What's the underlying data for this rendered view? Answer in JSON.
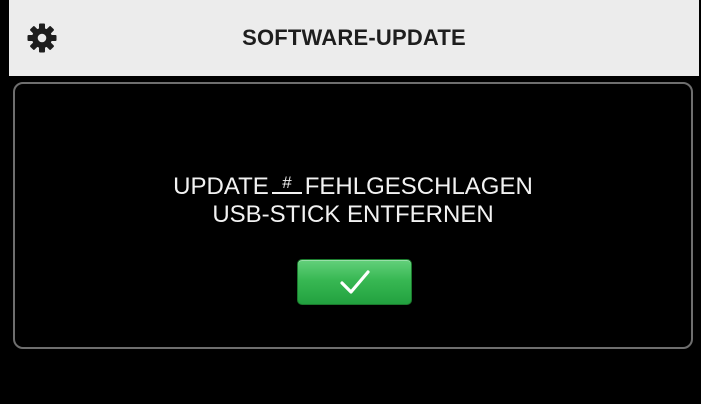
{
  "header": {
    "title": "SOFTWARE-UPDATE",
    "settings_icon": "gear-icon"
  },
  "dialog": {
    "line1_prefix": "UPDATE",
    "update_id": "#",
    "line1_suffix": "FEHLGESCHLAGEN",
    "line2": "USB-STICK ENTFERNEN",
    "confirm_icon": "checkmark-icon",
    "confirm_color": "#38b853"
  },
  "colors": {
    "header_bg": "#ececec",
    "screen_bg": "#000000",
    "panel_border": "#6e6e6e",
    "text": "#f2f2f2"
  }
}
